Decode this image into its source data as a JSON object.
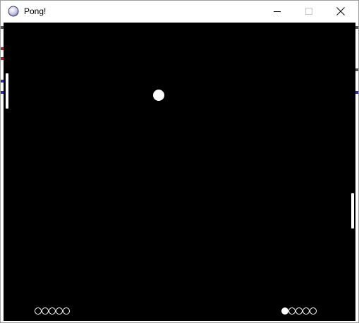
{
  "window": {
    "title": "Pong!"
  },
  "title_bar_buttons": {
    "minimize_icon": "minimize-icon",
    "maximize_icon": "maximize-icon",
    "close_icon": "close-icon"
  },
  "game": {
    "background_color": "#000000",
    "foreground_color": "#ffffff",
    "left_player": {
      "lives_total": 5,
      "lives_filled": 0
    },
    "right_player": {
      "lives_total": 5,
      "lives_filled": 1
    }
  }
}
